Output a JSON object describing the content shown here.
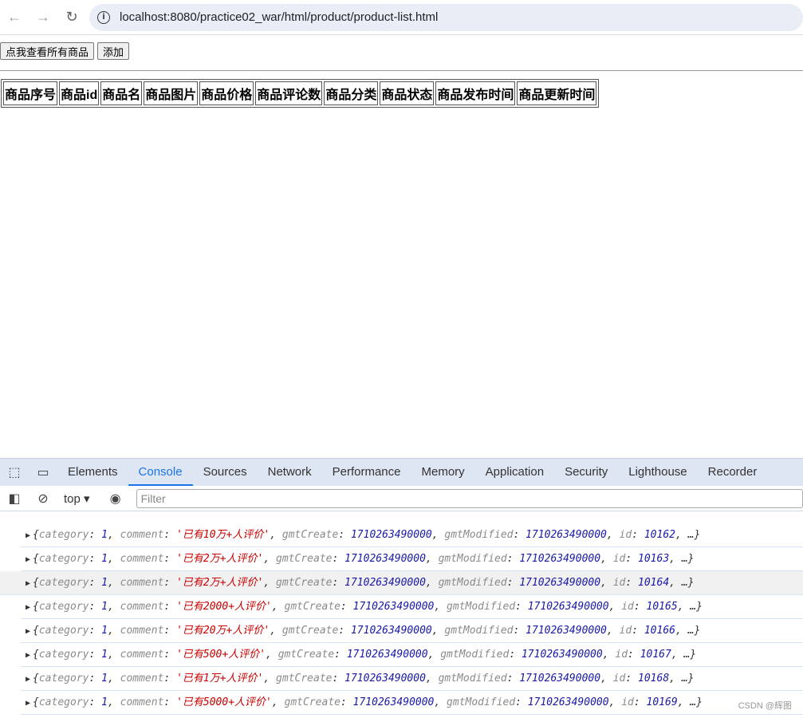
{
  "browser": {
    "url": "localhost:8080/practice02_war/html/product/product-list.html"
  },
  "page": {
    "buttons": [
      "点我查看所有商品",
      "添加"
    ],
    "table_headers": [
      "商品序号",
      "商品id",
      "商品名",
      "商品图片",
      "商品价格",
      "商品评论数",
      "商品分类",
      "商品状态",
      "商品发布时间",
      "商品更新时间"
    ]
  },
  "devtools": {
    "tabs": [
      "Elements",
      "Console",
      "Sources",
      "Network",
      "Performance",
      "Memory",
      "Application",
      "Security",
      "Lighthouse",
      "Recorder"
    ],
    "active_tab": "Console",
    "context": "top",
    "filter_placeholder": "Filter",
    "rows": [
      {
        "category": "1",
        "comment": "'已有10万+人评价'",
        "gmtCreate": "1710263490000",
        "gmtModified": "1710263490000",
        "id": "10162"
      },
      {
        "category": "1",
        "comment": "'已有2万+人评价'",
        "gmtCreate": "1710263490000",
        "gmtModified": "1710263490000",
        "id": "10163"
      },
      {
        "category": "1",
        "comment": "'已有2万+人评价'",
        "gmtCreate": "1710263490000",
        "gmtModified": "1710263490000",
        "id": "10164"
      },
      {
        "category": "1",
        "comment": "'已有2000+人评价'",
        "gmtCreate": "1710263490000",
        "gmtModified": "1710263490000",
        "id": "10165"
      },
      {
        "category": "1",
        "comment": "'已有20万+人评价'",
        "gmtCreate": "1710263490000",
        "gmtModified": "1710263490000",
        "id": "10166"
      },
      {
        "category": "1",
        "comment": "'已有500+人评价'",
        "gmtCreate": "1710263490000",
        "gmtModified": "1710263490000",
        "id": "10167"
      },
      {
        "category": "1",
        "comment": "'已有1万+人评价'",
        "gmtCreate": "1710263490000",
        "gmtModified": "1710263490000",
        "id": "10168"
      },
      {
        "category": "1",
        "comment": "'已有5000+人评价'",
        "gmtCreate": "1710263490000",
        "gmtModified": "1710263490000",
        "id": "10169"
      }
    ]
  },
  "watermark": "CSDN @辉图"
}
